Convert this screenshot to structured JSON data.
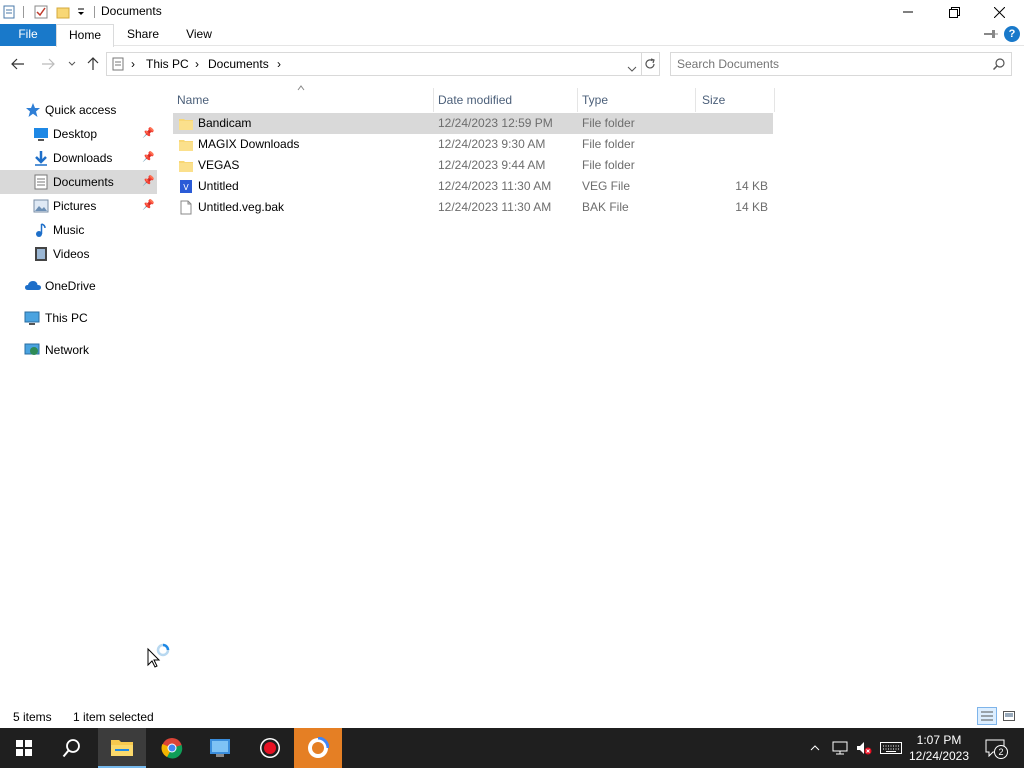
{
  "window": {
    "title": "Documents"
  },
  "ribbon": {
    "tabs": [
      "File",
      "Home",
      "Share",
      "View"
    ]
  },
  "address": {
    "crumbs": [
      "This PC",
      "Documents"
    ],
    "search_placeholder": "Search Documents"
  },
  "nav": {
    "quick_access": "Quick access",
    "items": [
      {
        "label": "Desktop",
        "icon": "desktop-icon",
        "pinned": true
      },
      {
        "label": "Downloads",
        "icon": "downloads-icon",
        "pinned": true
      },
      {
        "label": "Documents",
        "icon": "documents-icon",
        "pinned": true,
        "selected": true
      },
      {
        "label": "Pictures",
        "icon": "pictures-icon",
        "pinned": true
      },
      {
        "label": "Music",
        "icon": "music-icon",
        "pinned": false
      },
      {
        "label": "Videos",
        "icon": "videos-icon",
        "pinned": false
      }
    ],
    "onedrive": "OneDrive",
    "thispc": "This PC",
    "network": "Network"
  },
  "columns": [
    "Name",
    "Date modified",
    "Type",
    "Size"
  ],
  "files": [
    {
      "name": "Bandicam",
      "date": "12/24/2023 12:59 PM",
      "type": "File folder",
      "size": "",
      "icon": "folder-icon",
      "selected": true
    },
    {
      "name": "MAGIX Downloads",
      "date": "12/24/2023 9:30 AM",
      "type": "File folder",
      "size": "",
      "icon": "folder-icon"
    },
    {
      "name": "VEGAS",
      "date": "12/24/2023 9:44 AM",
      "type": "File folder",
      "size": "",
      "icon": "folder-icon"
    },
    {
      "name": "Untitled",
      "date": "12/24/2023 11:30 AM",
      "type": "VEG File",
      "size": "14 KB",
      "icon": "veg-file-icon"
    },
    {
      "name": "Untitled.veg.bak",
      "date": "12/24/2023 11:30 AM",
      "type": "BAK File",
      "size": "14 KB",
      "icon": "file-icon"
    }
  ],
  "status": {
    "count": "5 items",
    "selection": "1 item selected"
  },
  "clock": {
    "time": "1:07 PM",
    "date": "12/24/2023"
  },
  "notifications": "2",
  "colors": {
    "accent": "#1979ca",
    "selection": "#d9d9d9",
    "taskbar": "#1f1f1f",
    "folder": "#f8d775"
  }
}
